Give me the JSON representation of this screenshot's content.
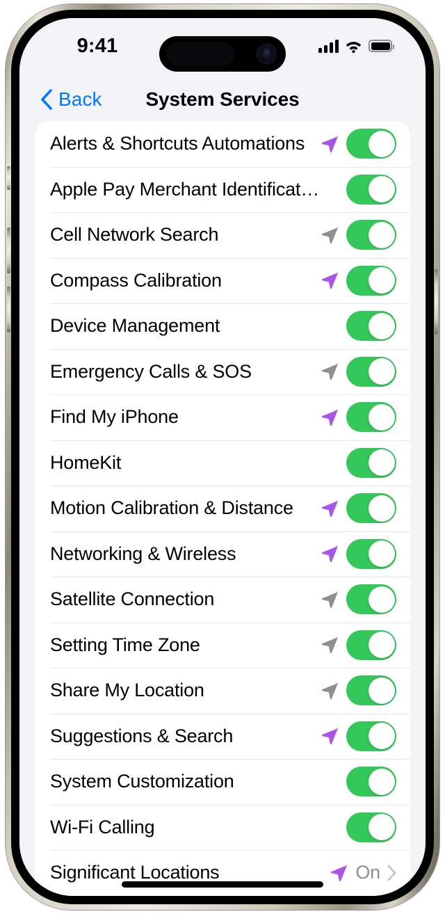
{
  "status_bar": {
    "time": "9:41",
    "cellular_icon": "cellular-bars-icon",
    "wifi_icon": "wifi-icon",
    "battery_icon": "battery-full-icon"
  },
  "nav": {
    "back_label": "Back",
    "back_icon": "chevron-left-icon",
    "title": "System Services"
  },
  "colors": {
    "toggle_on": "#34C759",
    "accent_blue": "#007AFF",
    "arrow_active": "#A855E8",
    "arrow_recent": "#8E8E93",
    "page_background": "#F2F2F7",
    "card_background": "#FFFFFF"
  },
  "list": {
    "rows": [
      {
        "label": "Alerts & Shortcuts Automations",
        "arrow": "purple",
        "control": "toggle",
        "toggle_on": true
      },
      {
        "label": "Apple Pay Merchant Identificat…",
        "arrow": "none",
        "control": "toggle",
        "toggle_on": true
      },
      {
        "label": "Cell Network Search",
        "arrow": "gray",
        "control": "toggle",
        "toggle_on": true
      },
      {
        "label": "Compass Calibration",
        "arrow": "purple",
        "control": "toggle",
        "toggle_on": true
      },
      {
        "label": "Device Management",
        "arrow": "none",
        "control": "toggle",
        "toggle_on": true
      },
      {
        "label": "Emergency Calls & SOS",
        "arrow": "gray",
        "control": "toggle",
        "toggle_on": true
      },
      {
        "label": "Find My iPhone",
        "arrow": "purple",
        "control": "toggle",
        "toggle_on": true
      },
      {
        "label": "HomeKit",
        "arrow": "none",
        "control": "toggle",
        "toggle_on": true
      },
      {
        "label": "Motion Calibration & Distance",
        "arrow": "purple",
        "control": "toggle",
        "toggle_on": true
      },
      {
        "label": "Networking & Wireless",
        "arrow": "purple",
        "control": "toggle",
        "toggle_on": true
      },
      {
        "label": "Satellite Connection",
        "arrow": "gray",
        "control": "toggle",
        "toggle_on": true
      },
      {
        "label": "Setting Time Zone",
        "arrow": "gray",
        "control": "toggle",
        "toggle_on": true
      },
      {
        "label": "Share My Location",
        "arrow": "gray",
        "control": "toggle",
        "toggle_on": true
      },
      {
        "label": "Suggestions & Search",
        "arrow": "purple",
        "control": "toggle",
        "toggle_on": true
      },
      {
        "label": "System Customization",
        "arrow": "none",
        "control": "toggle",
        "toggle_on": true
      },
      {
        "label": "Wi-Fi Calling",
        "arrow": "none",
        "control": "toggle",
        "toggle_on": true
      },
      {
        "label": "Significant Locations",
        "arrow": "purple",
        "control": "disclosure",
        "value": "On"
      }
    ]
  }
}
